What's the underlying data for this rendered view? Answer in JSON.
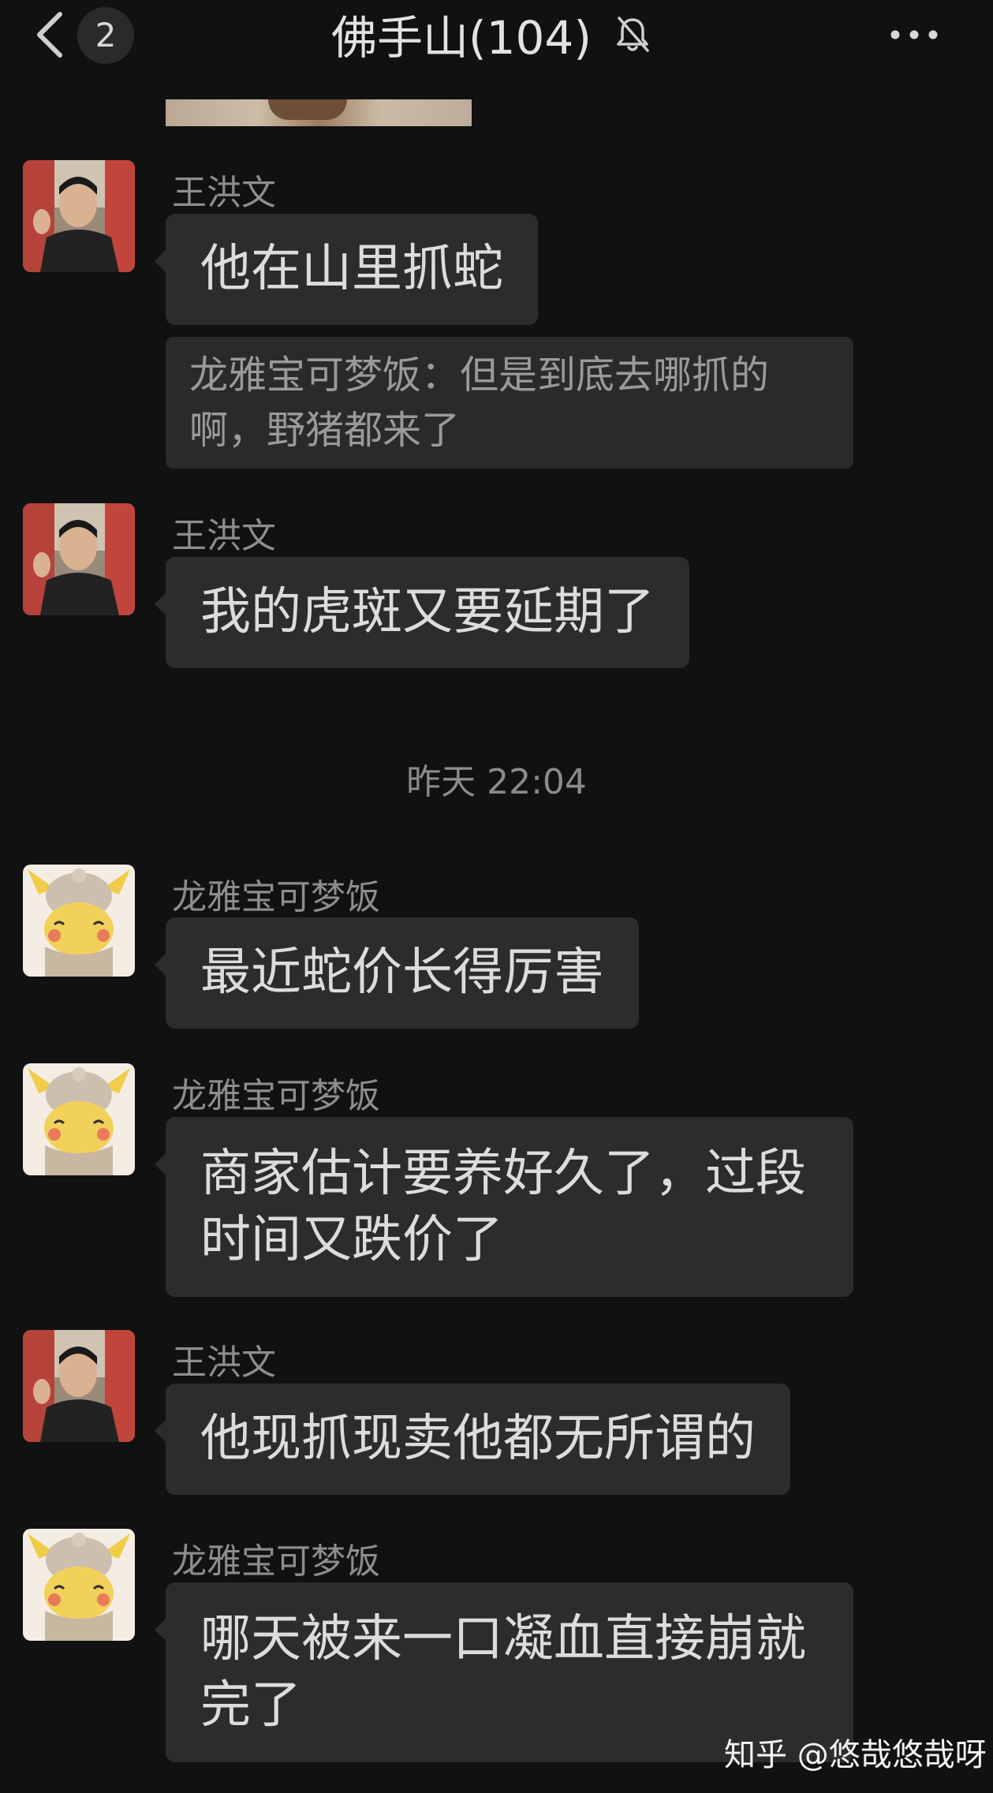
{
  "header": {
    "unread_count": "2",
    "title": "佛手山(104)",
    "back_icon": "chevron-left-icon",
    "mute_icon": "bell-slash-icon",
    "more_icon": "more-dots-icon"
  },
  "messages": [
    {
      "sender": "王洪文",
      "text": "他在山里抓蛇"
    },
    {
      "quote": "龙雅宝可梦饭：但是到底去哪抓的\n啊，野猪都来了"
    },
    {
      "sender": "王洪文",
      "text": "我的虎斑又要延期了"
    },
    {
      "timestamp": "昨天 22:04"
    },
    {
      "sender": "龙雅宝可梦饭",
      "text": "最近蛇价长得厉害"
    },
    {
      "sender": "龙雅宝可梦饭",
      "text": "商家估计要养好久了，过段\n时间又跌价了"
    },
    {
      "sender": "王洪文",
      "text": "他现抓现卖他都无所谓的"
    },
    {
      "sender": "龙雅宝可梦饭",
      "text": "哪天被来一口凝血直接崩就\n完了"
    }
  ],
  "watermark": "知乎 @悠哉悠哉呀",
  "colors": {
    "background": "#111111",
    "bubble": "#2c2c2c",
    "bubble_text": "#dcdcdc",
    "sender_text": "#8d8d8d"
  }
}
